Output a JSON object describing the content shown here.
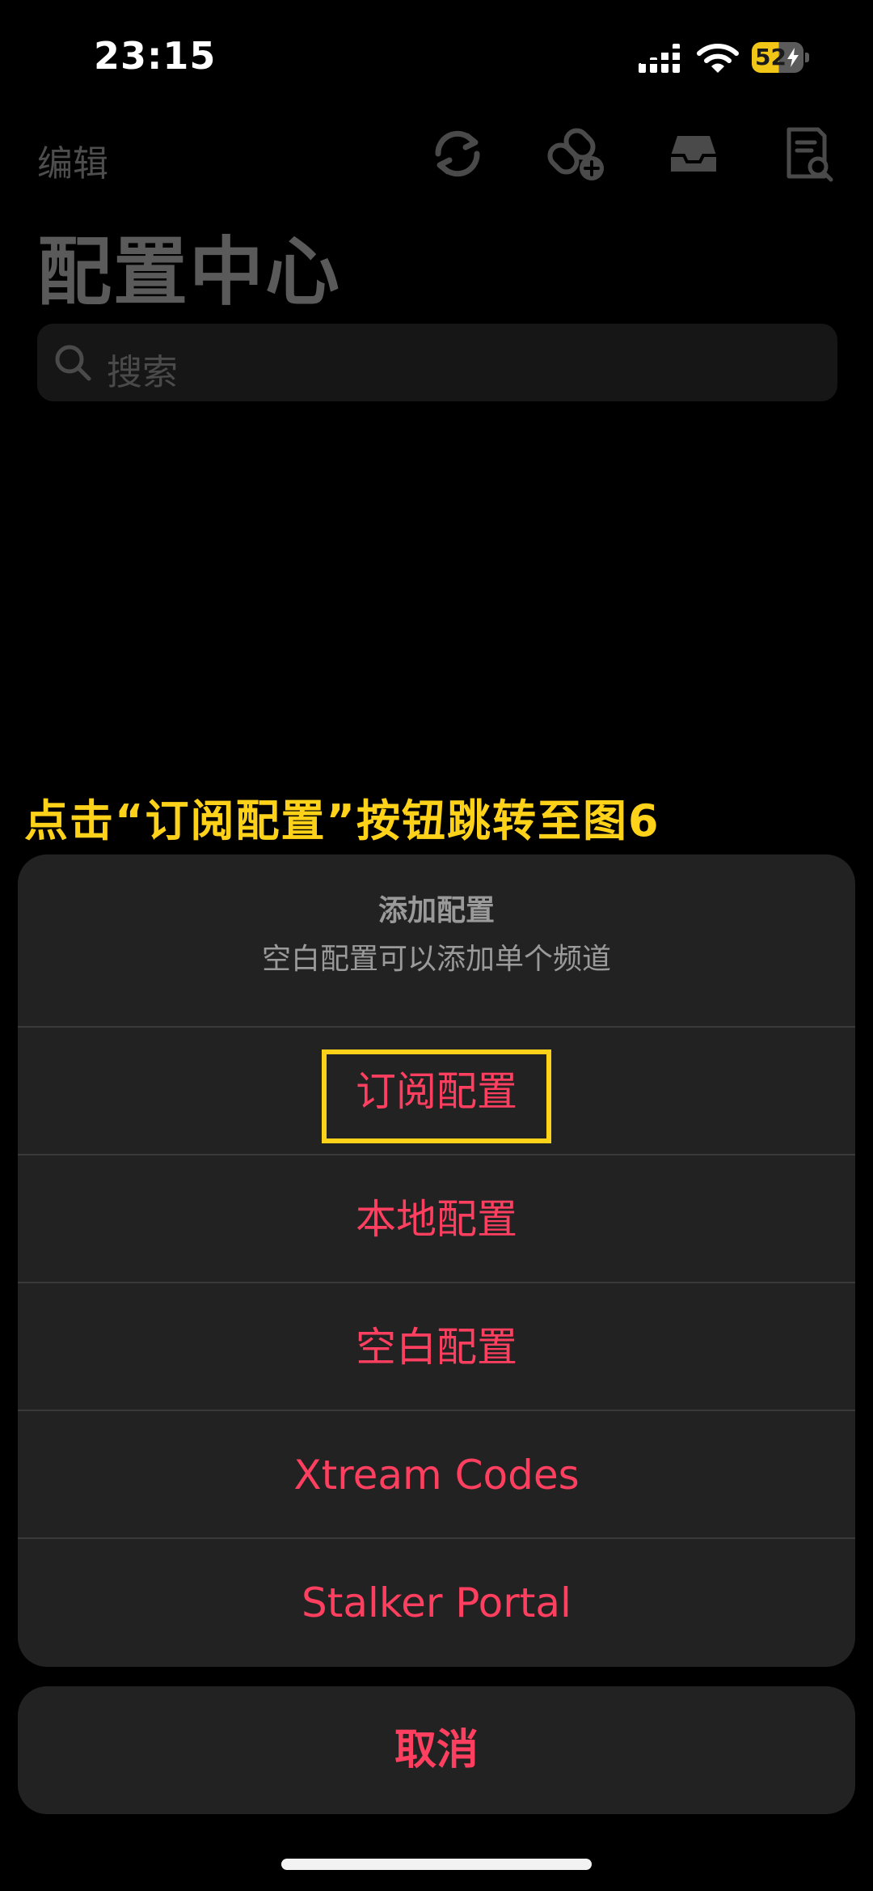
{
  "status_bar": {
    "time": "23:15",
    "battery_level": "52",
    "icons": [
      "cellular-signal-icon",
      "wifi-icon",
      "battery-charging-icon"
    ]
  },
  "background": {
    "nav": {
      "edit_label": "编辑",
      "icons": [
        "refresh-icon",
        "add-link-icon",
        "inbox-icon",
        "document-search-icon"
      ]
    },
    "title": "配置中心",
    "search": {
      "placeholder": "搜索"
    }
  },
  "annotation": {
    "text": "点击“订阅配置”按钮跳转至图6",
    "color": "#ffd21a"
  },
  "action_sheet": {
    "title": "添加配置",
    "message": "空白配置可以添加单个频道",
    "actions": [
      {
        "label": "订阅配置",
        "highlighted": true
      },
      {
        "label": "本地配置"
      },
      {
        "label": "空白配置"
      },
      {
        "label": "Xtream Codes"
      },
      {
        "label": "Stalker Portal"
      }
    ],
    "cancel_label": "取消",
    "accent_color": "#ff3f5f"
  }
}
